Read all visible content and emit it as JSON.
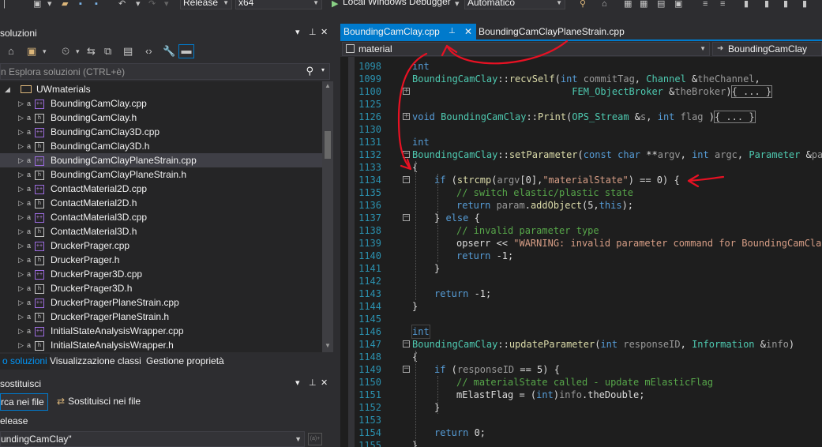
{
  "toolbar": {
    "config": "Release",
    "platform": "x64",
    "debugger": "Local Windows Debugger",
    "debugger_mode": "Automatico"
  },
  "solution_explorer": {
    "title": "soluzioni",
    "search_placeholder": "n Esplora soluzioni (CTRL+è)",
    "project": "UWmaterials",
    "files": [
      {
        "name": "BoundingCamClay.cpp",
        "type": "cpp"
      },
      {
        "name": "BoundingCamClay.h",
        "type": "h"
      },
      {
        "name": "BoundingCamClay3D.cpp",
        "type": "cpp"
      },
      {
        "name": "BoundingCamClay3D.h",
        "type": "h"
      },
      {
        "name": "BoundingCamClayPlaneStrain.cpp",
        "type": "cpp"
      },
      {
        "name": "BoundingCamClayPlaneStrain.h",
        "type": "h"
      },
      {
        "name": "ContactMaterial2D.cpp",
        "type": "cpp"
      },
      {
        "name": "ContactMaterial2D.h",
        "type": "h"
      },
      {
        "name": "ContactMaterial3D.cpp",
        "type": "cpp"
      },
      {
        "name": "ContactMaterial3D.h",
        "type": "h"
      },
      {
        "name": "DruckerPrager.cpp",
        "type": "cpp"
      },
      {
        "name": "DruckerPrager.h",
        "type": "h"
      },
      {
        "name": "DruckerPrager3D.cpp",
        "type": "cpp"
      },
      {
        "name": "DruckerPrager3D.h",
        "type": "h"
      },
      {
        "name": "DruckerPragerPlaneStrain.cpp",
        "type": "cpp"
      },
      {
        "name": "DruckerPragerPlaneStrain.h",
        "type": "h"
      },
      {
        "name": "InitialStateAnalysisWrapper.cpp",
        "type": "cpp"
      },
      {
        "name": "InitialStateAnalysisWrapper.h",
        "type": "h"
      }
    ],
    "selected_file": "BoundingCamClayPlaneStrain.cpp"
  },
  "bottom_tabs": [
    "o soluzioni",
    "Visualizzazione classi",
    "Gestione proprietà"
  ],
  "find_panel": {
    "title": "sostituisci",
    "find_tab": "rca nei file",
    "replace_tab": "Sostituisci nei file",
    "label": "elease",
    "query": "undingCamClay\"",
    "regex_icon": "(a)+"
  },
  "editor": {
    "active_tab": "BoundingCamClay.cpp",
    "other_tab": "BoundingCamClayPlaneStrain.cpp",
    "nav_left": "material",
    "nav_right": "BoundingCamClay",
    "collapsed_marker": "{ ... }",
    "lines": [
      {
        "n": "1098",
        "fold": "",
        "indent": 0,
        "tokens": [
          [
            "kw",
            "int"
          ]
        ]
      },
      {
        "n": "1099",
        "fold": "",
        "indent": 0,
        "tokens": [
          [
            "ty",
            "BoundingCamClay"
          ],
          [
            "",
            "::"
          ],
          [
            "fn",
            "recvSelf"
          ],
          [
            "",
            "("
          ],
          [
            "kw",
            "int"
          ],
          [
            "pr",
            " commitTag"
          ],
          [
            "",
            ", "
          ],
          [
            "ty",
            "Channel"
          ],
          [
            "",
            " &"
          ],
          [
            "pr",
            "theChannel"
          ],
          [
            "",
            ","
          ]
        ]
      },
      {
        "n": "1100",
        "fold": "+",
        "indent": 0,
        "tokens": [
          [
            "",
            "                            "
          ],
          [
            "ty",
            "FEM_ObjectBroker"
          ],
          [
            "",
            " &"
          ],
          [
            "pr",
            "theBroker"
          ],
          [
            "",
            ")"
          ],
          [
            "cl",
            "{ ... }"
          ]
        ]
      },
      {
        "n": "1125",
        "fold": "",
        "indent": 0,
        "tokens": []
      },
      {
        "n": "1126",
        "fold": "+",
        "indent": 0,
        "tokens": [
          [
            "kw",
            "void"
          ],
          [
            "",
            " "
          ],
          [
            "ty",
            "BoundingCamClay"
          ],
          [
            "",
            "::"
          ],
          [
            "fn",
            "Print"
          ],
          [
            "",
            "("
          ],
          [
            "ty",
            "OPS_Stream"
          ],
          [
            "",
            " &"
          ],
          [
            "pr",
            "s"
          ],
          [
            "",
            ", "
          ],
          [
            "kw",
            "int"
          ],
          [
            "pr",
            " flag"
          ],
          [
            "",
            " )"
          ],
          [
            "cl",
            "{ ... }"
          ]
        ]
      },
      {
        "n": "1130",
        "fold": "",
        "indent": 0,
        "tokens": []
      },
      {
        "n": "1131",
        "fold": "",
        "indent": 0,
        "tokens": [
          [
            "kw",
            "int"
          ]
        ]
      },
      {
        "n": "1132",
        "fold": "-",
        "indent": 0,
        "tokens": [
          [
            "ty",
            "BoundingCamClay"
          ],
          [
            "",
            "::"
          ],
          [
            "fn",
            "setParameter"
          ],
          [
            "",
            "("
          ],
          [
            "kw",
            "const"
          ],
          [
            "",
            " "
          ],
          [
            "kw",
            "char"
          ],
          [
            "",
            " **"
          ],
          [
            "pr",
            "argv"
          ],
          [
            "",
            ", "
          ],
          [
            "kw",
            "int"
          ],
          [
            "pr",
            " argc"
          ],
          [
            "",
            ", "
          ],
          [
            "ty",
            "Parameter"
          ],
          [
            "",
            " &"
          ],
          [
            "pr",
            "param"
          ]
        ]
      },
      {
        "n": "1133",
        "fold": "",
        "indent": 0,
        "tokens": [
          [
            "",
            "{"
          ]
        ]
      },
      {
        "n": "1134",
        "fold": "-",
        "indent": 1,
        "tokens": [
          [
            "kw",
            "if"
          ],
          [
            "",
            " ("
          ],
          [
            "fn",
            "strcmp"
          ],
          [
            "",
            "("
          ],
          [
            "pr",
            "argv"
          ],
          [
            "",
            "[0],"
          ],
          [
            "st",
            "\"materialState\""
          ],
          [
            "",
            ") == 0) {"
          ]
        ]
      },
      {
        "n": "1135",
        "fold": "",
        "indent": 2,
        "tokens": [
          [
            "cm",
            "// switch elastic/plastic state"
          ]
        ]
      },
      {
        "n": "1136",
        "fold": "",
        "indent": 2,
        "tokens": [
          [
            "kw",
            "return"
          ],
          [
            "pr",
            " param"
          ],
          [
            "",
            "."
          ],
          [
            "fn",
            "addObject"
          ],
          [
            "",
            "(5,"
          ],
          [
            "kw",
            "this"
          ],
          [
            "",
            ");"
          ]
        ]
      },
      {
        "n": "1137",
        "fold": "-",
        "indent": 1,
        "tokens": [
          [
            "",
            "} "
          ],
          [
            "kw",
            "else"
          ],
          [
            "",
            " {"
          ]
        ]
      },
      {
        "n": "1138",
        "fold": "",
        "indent": 2,
        "tokens": [
          [
            "cm",
            "// invalid parameter type"
          ]
        ]
      },
      {
        "n": "1139",
        "fold": "",
        "indent": 2,
        "tokens": [
          [
            "",
            "opserr << "
          ],
          [
            "st",
            "\"WARNING: invalid parameter command for BoundingCamClay"
          ]
        ]
      },
      {
        "n": "1140",
        "fold": "",
        "indent": 2,
        "tokens": [
          [
            "kw",
            "return"
          ],
          [
            "",
            " -1;"
          ]
        ]
      },
      {
        "n": "1141",
        "fold": "",
        "indent": 1,
        "tokens": [
          [
            "",
            "}"
          ]
        ]
      },
      {
        "n": "1142",
        "fold": "",
        "indent": 0,
        "tokens": []
      },
      {
        "n": "1143",
        "fold": "",
        "indent": 1,
        "tokens": [
          [
            "kw",
            "return"
          ],
          [
            "",
            " -1;"
          ]
        ]
      },
      {
        "n": "1144",
        "fold": "",
        "indent": 0,
        "tokens": [
          [
            "",
            "}"
          ]
        ]
      },
      {
        "n": "1145",
        "fold": "",
        "indent": 0,
        "tokens": []
      },
      {
        "n": "1146",
        "fold": "",
        "indent": 0,
        "hl": true,
        "tokens": [
          [
            "kw",
            "int"
          ]
        ]
      },
      {
        "n": "1147",
        "fold": "-",
        "indent": 0,
        "tokens": [
          [
            "ty",
            "BoundingCamClay"
          ],
          [
            "",
            "::"
          ],
          [
            "fn",
            "updateParameter"
          ],
          [
            "",
            "("
          ],
          [
            "kw",
            "int"
          ],
          [
            "pr",
            " responseID"
          ],
          [
            "",
            ", "
          ],
          [
            "ty",
            "Information"
          ],
          [
            "",
            " &"
          ],
          [
            "pr",
            "info"
          ],
          [
            "",
            ")"
          ]
        ]
      },
      {
        "n": "1148",
        "fold": "",
        "indent": 0,
        "tokens": [
          [
            "",
            "{"
          ]
        ]
      },
      {
        "n": "1149",
        "fold": "-",
        "indent": 1,
        "tokens": [
          [
            "kw",
            "if"
          ],
          [
            "",
            " ("
          ],
          [
            "pr",
            "responseID"
          ],
          [
            "",
            " == 5) {"
          ]
        ]
      },
      {
        "n": "1150",
        "fold": "",
        "indent": 2,
        "tokens": [
          [
            "cm",
            "// materialState called - update mElasticFlag"
          ]
        ]
      },
      {
        "n": "1151",
        "fold": "",
        "indent": 2,
        "tokens": [
          [
            "",
            "mElastFlag = ("
          ],
          [
            "kw",
            "int"
          ],
          [
            "",
            ")"
          ],
          [
            "pr",
            "info"
          ],
          [
            "",
            "."
          ],
          [
            "",
            "theDouble;"
          ]
        ]
      },
      {
        "n": "1152",
        "fold": "",
        "indent": 1,
        "tokens": [
          [
            "",
            "}"
          ]
        ]
      },
      {
        "n": "1153",
        "fold": "",
        "indent": 0,
        "tokens": []
      },
      {
        "n": "1154",
        "fold": "",
        "indent": 1,
        "tokens": [
          [
            "kw",
            "return"
          ],
          [
            "",
            " 0;"
          ]
        ]
      },
      {
        "n": "1155",
        "fold": "",
        "indent": 0,
        "tokens": [
          [
            "",
            "}"
          ]
        ]
      }
    ]
  },
  "colors": {
    "accent": "#007acc",
    "annotation": "#e81123",
    "editor_bg": "#1e1e1e"
  }
}
